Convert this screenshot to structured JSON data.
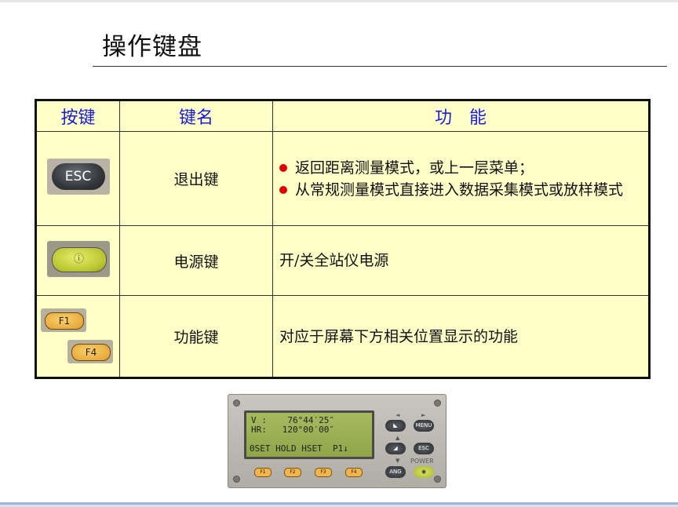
{
  "title": "操作键盘",
  "table": {
    "headers": [
      "按键",
      "键名",
      "功　能"
    ],
    "rows": [
      {
        "key_label": "ESC",
        "name": "退出键",
        "functions": [
          "返回距离测量模式，或上一层菜单；",
          "从常规测量模式直接进入数据采集模式或放样模式"
        ]
      },
      {
        "key_label": "ⓘ",
        "name": "电源键",
        "functions": [
          "开/关全站仪电源"
        ]
      },
      {
        "key_labels": [
          "F1",
          "F4"
        ],
        "name": "功能键",
        "functions": [
          "对应于屏幕下方相关位置显示的功能"
        ]
      }
    ]
  },
  "device": {
    "lcd_lines": [
      "V :    76°44′25″",
      "HR:   120°00′00″",
      "0SET HOLD HSET  P1↓"
    ],
    "buttons": [
      "MENU",
      "ESC",
      "ANG"
    ],
    "power_label": "POWER",
    "fkeys": [
      "F1",
      "F2",
      "F3",
      "F4"
    ]
  }
}
